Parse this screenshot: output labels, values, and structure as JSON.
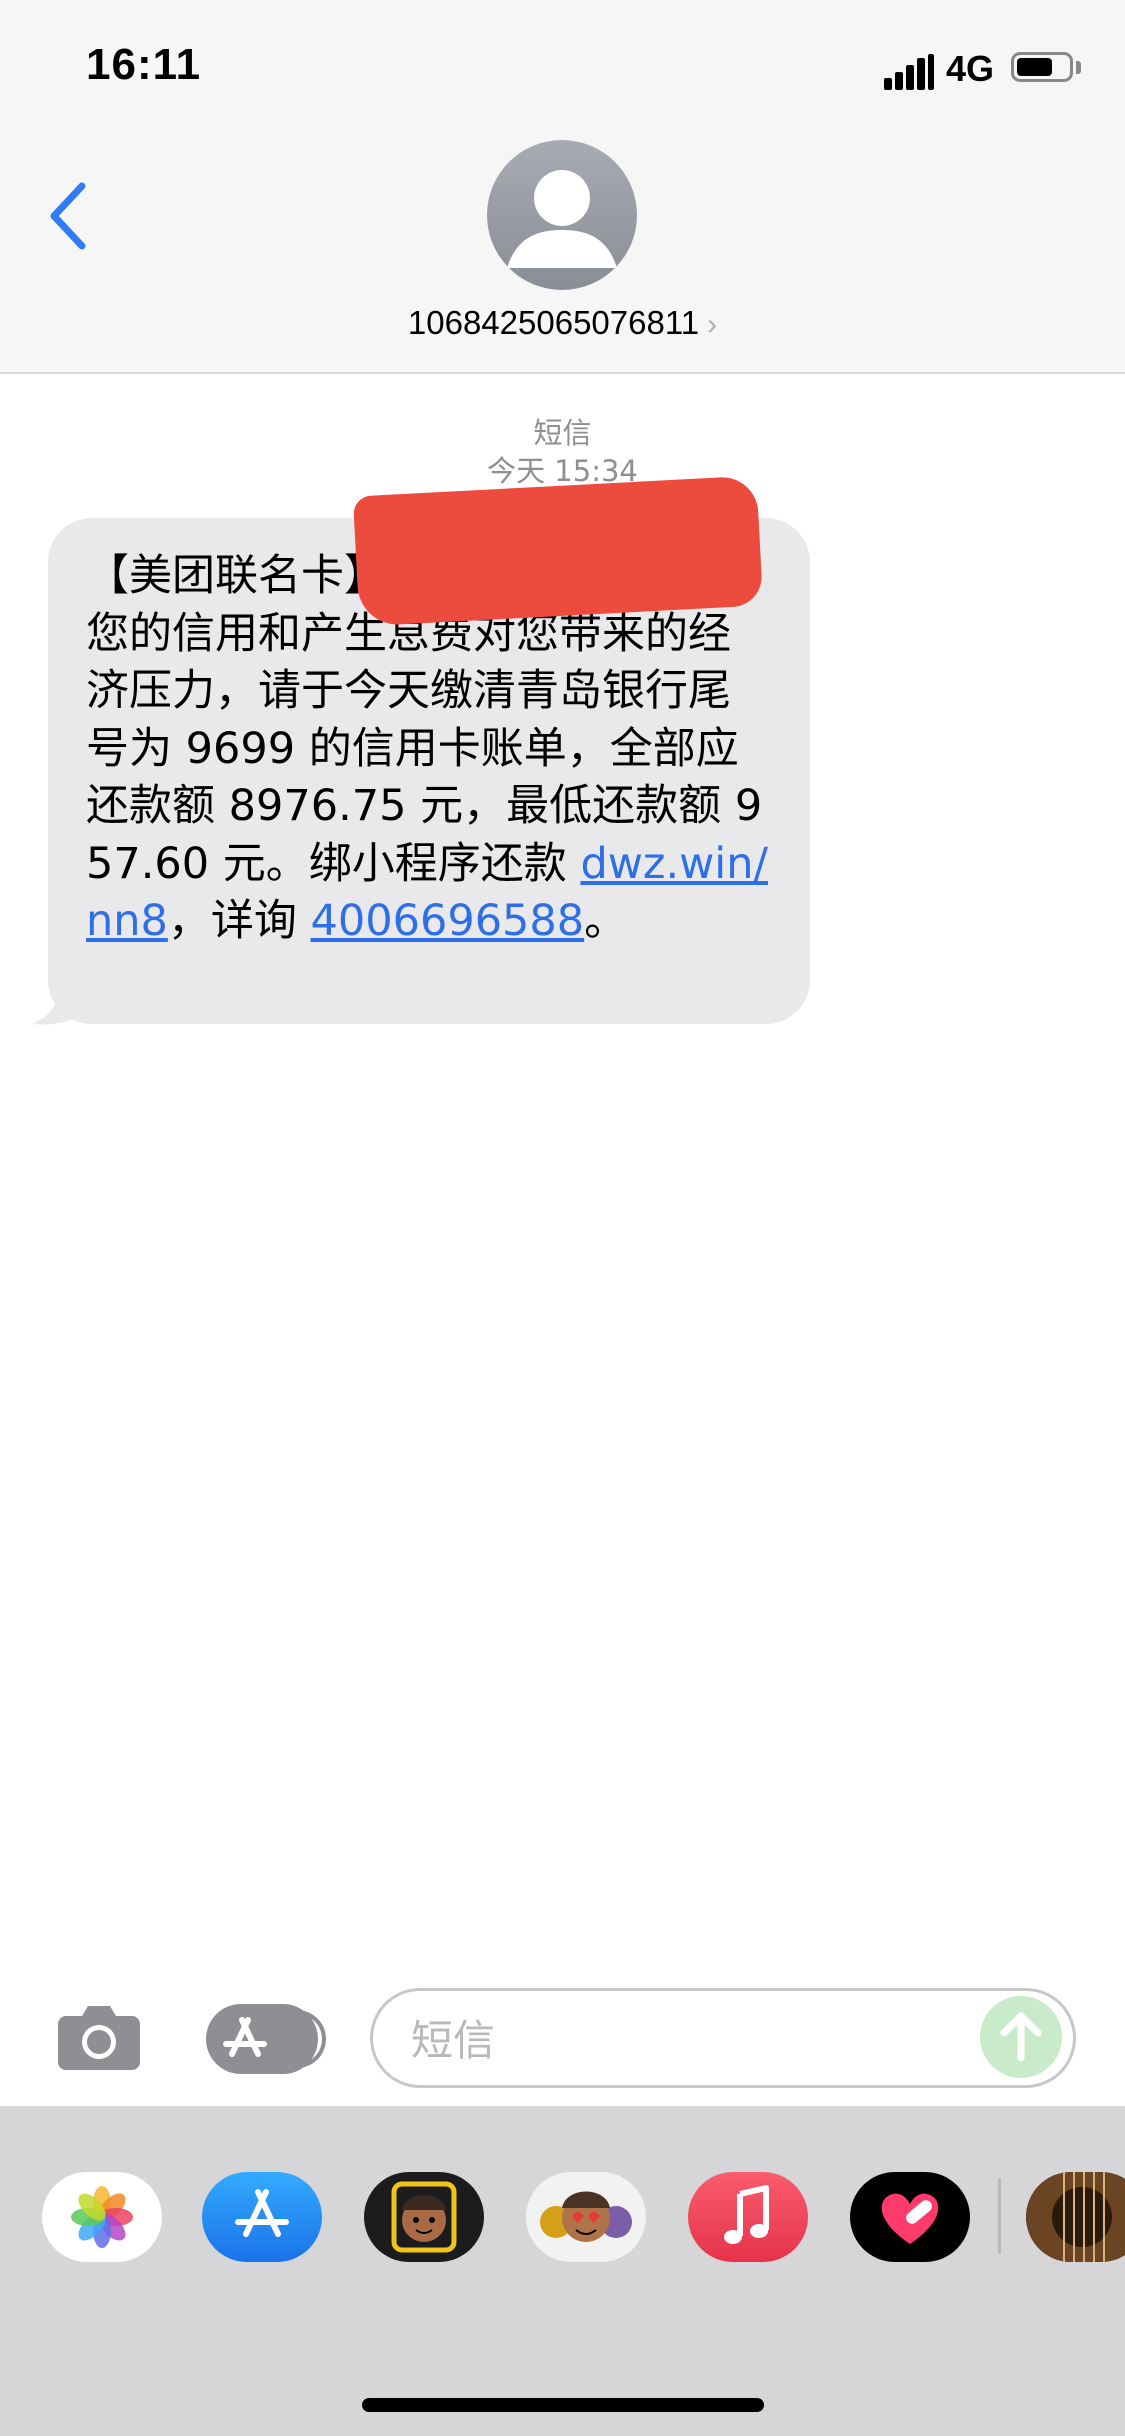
{
  "status_bar": {
    "time": "16:11",
    "network": "4G",
    "battery_level": 0.7
  },
  "header": {
    "contact_number": "1068425065076811",
    "chevron": "›",
    "avatar_icon": "person-silhouette-icon",
    "back_icon": "chevron-left-icon"
  },
  "conversation": {
    "service_label": "短信",
    "timestamp": "今天 15:34",
    "message": {
      "prefix": "【美团联名卡】请",
      "body": "您好，避免影响您的信用和产生息费对您带来的经济压力，请于今天缴清青岛银行尾号为 9699 的信用卡账单，全部应还款额 8976.75 元，最低还款额 957.60 元。绑小程序还款 ",
      "link": "dwz.win/nn8",
      "middle": "，详询 ",
      "phone": "4006696588",
      "suffix": "。"
    }
  },
  "compose": {
    "placeholder": "短信"
  },
  "drawer": {
    "apps": [
      "photos-icon",
      "app-store-icon",
      "memoji-icon",
      "animoji-stickers-icon",
      "music-icon",
      "digital-touch-icon",
      "guitar-app-icon"
    ]
  },
  "colors": {
    "link": "#2c6fe8",
    "bubble": "#e9e9eb",
    "accent_back": "#2f7cf6",
    "redaction": "#ec4b3e"
  }
}
